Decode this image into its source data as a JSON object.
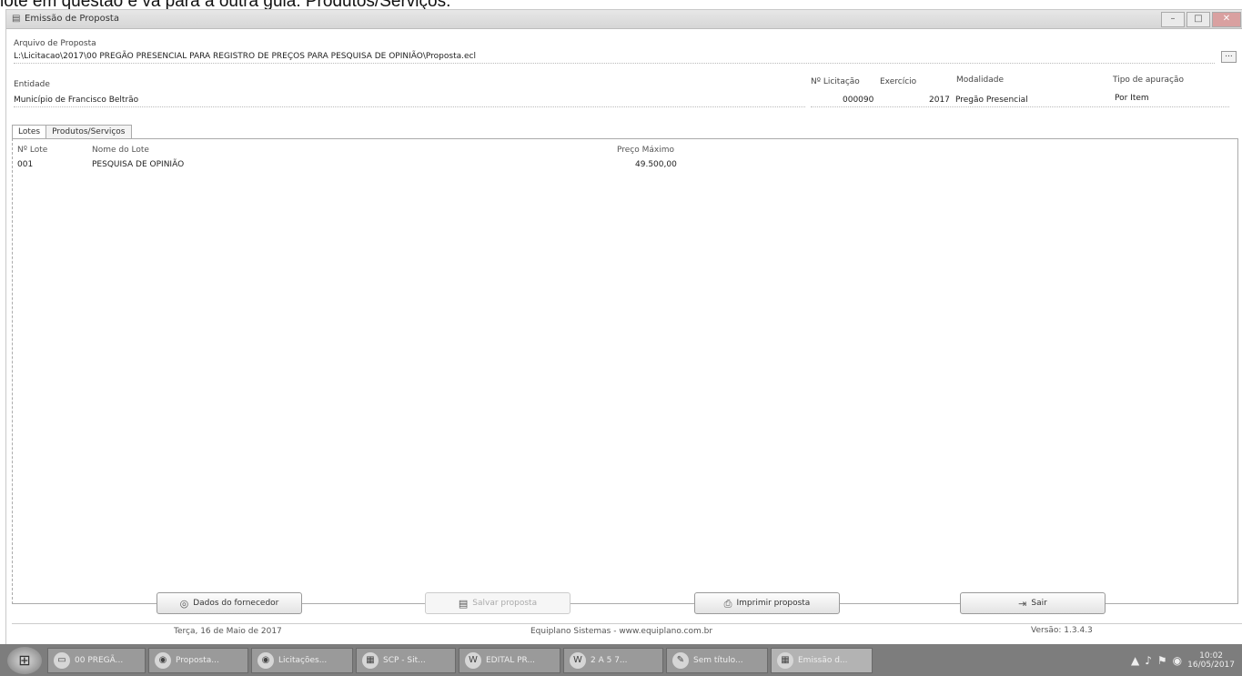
{
  "caption": "lote em questão e vá para a outra guia: Produtos/Serviços.",
  "window": {
    "title": "Emissão de Proposta",
    "app_icon": "document-icon",
    "minimize": "–",
    "maximize": "□",
    "close": "✕"
  },
  "arquivo": {
    "label": "Arquivo de Proposta",
    "path": "L:\\Licitacao\\2017\\00 PREGÃO PRESENCIAL PARA REGISTRO DE PREÇOS PARA PESQUISA DE OPINIÃO\\Proposta.ecl",
    "browse": "..."
  },
  "entidade": {
    "label": "Entidade",
    "value": "Município de Francisco Beltrão"
  },
  "licitacao": {
    "label": "Nº Licitação",
    "value": "000090"
  },
  "exercicio": {
    "label": "Exercício",
    "value": "2017"
  },
  "modalidade": {
    "label": "Modalidade",
    "value": "Pregão Presencial"
  },
  "apuracao": {
    "label": "Tipo de apuração",
    "value": "Por Item"
  },
  "tabs": [
    {
      "label": "Lotes"
    },
    {
      "label": "Produtos/Serviços"
    }
  ],
  "table": {
    "headers": {
      "lote": "Nº Lote",
      "nome": "Nome do Lote",
      "preco": "Preço Máximo"
    },
    "rows": [
      {
        "lote": "001",
        "nome": "PESQUISA DE OPINIÃO",
        "preco": "49.500,00"
      }
    ]
  },
  "buttons": {
    "fornecedor": "Dados do fornecedor",
    "salvar": "Salvar proposta",
    "imprimir": "Imprimir proposta",
    "sair": "Sair"
  },
  "status": {
    "date": "Terça, 16 de Maio de 2017",
    "company": "Equiplano Sistemas - www.equiplano.com.br",
    "version": "Versão: 1.3.4.3"
  },
  "taskbar": {
    "items": [
      {
        "label": "00 PREGÃ...",
        "icon": "folder-icon"
      },
      {
        "label": "Proposta...",
        "icon": "chrome-icon"
      },
      {
        "label": "Licitações...",
        "icon": "chrome-icon"
      },
      {
        "label": "SCP - Sit...",
        "icon": "app-icon"
      },
      {
        "label": "EDITAL PR...",
        "icon": "word-icon"
      },
      {
        "label": "2 A 5 7...",
        "icon": "word-icon"
      },
      {
        "label": "Sem título...",
        "icon": "paint-icon"
      },
      {
        "label": "Emissão d...",
        "icon": "app-icon"
      }
    ],
    "clock_time": "10:02",
    "clock_date": "16/05/2017"
  }
}
